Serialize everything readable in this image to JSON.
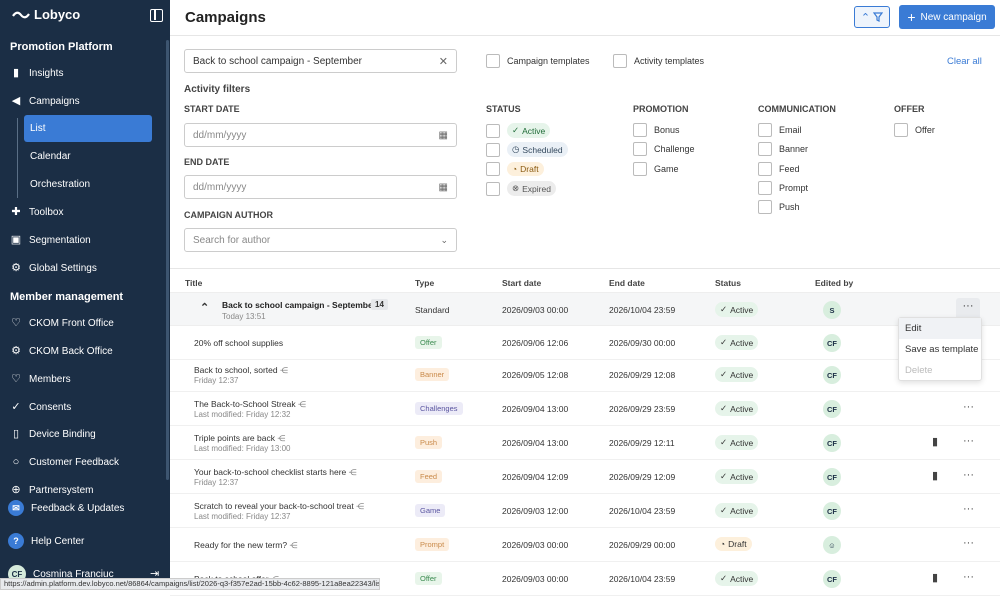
{
  "app": {
    "name": "Lobyco"
  },
  "sidebar": {
    "section1": "Promotion Platform",
    "items1": [
      {
        "label": "Insights",
        "icon": "bar-chart-icon"
      },
      {
        "label": "Campaigns",
        "icon": "megaphone-icon"
      }
    ],
    "campaign_sub": [
      "List",
      "Calendar",
      "Orchestration"
    ],
    "items2": [
      {
        "label": "Toolbox",
        "icon": "puzzle-icon"
      },
      {
        "label": "Segmentation",
        "icon": "segment-icon"
      },
      {
        "label": "Global Settings",
        "icon": "gear-icon"
      }
    ],
    "section2": "Member management",
    "items3": [
      {
        "label": "CKOM Front Office",
        "icon": "heart-icon"
      },
      {
        "label": "CKOM Back Office",
        "icon": "gear-icon"
      },
      {
        "label": "Members",
        "icon": "heart-icon"
      },
      {
        "label": "Consents",
        "icon": "check-circle-icon"
      },
      {
        "label": "Device Binding",
        "icon": "phone-icon"
      },
      {
        "label": "Customer Feedback",
        "icon": "chat-icon"
      },
      {
        "label": "Partnersystem",
        "icon": "partner-icon"
      }
    ],
    "bottom": {
      "feedback": "Feedback & Updates",
      "help": "Help Center",
      "user_initials": "CF",
      "user_name": "Cosmina Franciuc"
    }
  },
  "header": {
    "title": "Campaigns",
    "new_button": "New campaign"
  },
  "filters": {
    "search_value": "Back to school campaign - September",
    "campaign_templates": "Campaign templates",
    "activity_templates": "Activity templates",
    "clear_all": "Clear all",
    "activity_filters": "Activity filters",
    "start_date_label": "START DATE",
    "end_date_label": "END DATE",
    "date_placeholder": "dd/mm/yyyy",
    "author_label": "CAMPAIGN AUTHOR",
    "author_placeholder": "Search for author",
    "status_label": "STATUS",
    "status_options": [
      "Active",
      "Scheduled",
      "Draft",
      "Expired"
    ],
    "promotion_label": "PROMOTION",
    "promotion_options": [
      "Bonus",
      "Challenge",
      "Game"
    ],
    "communication_label": "COMMUNICATION",
    "communication_options": [
      "Email",
      "Banner",
      "Feed",
      "Prompt",
      "Push"
    ],
    "offer_label": "OFFER",
    "offer_options": [
      "Offer"
    ]
  },
  "table": {
    "headers": [
      "Title",
      "Type",
      "Start date",
      "End date",
      "Status",
      "Edited by"
    ],
    "group": {
      "title": "Back to school campaign - September",
      "count": "14",
      "subtitle": "Today 13:51",
      "type": "Standard",
      "start": "2026/09/03 00:00",
      "end": "2026/10/04 23:59",
      "status": "Active",
      "edited_by": "S"
    },
    "rows": [
      {
        "title": "20% off school supplies",
        "sub": "",
        "type": "Offer",
        "start": "2026/09/06 12:06",
        "end": "2026/09/30 00:00",
        "status": "Active",
        "editor": "CF",
        "share": false,
        "chart": false,
        "dots": false
      },
      {
        "title": "Back to school, sorted",
        "sub": "Friday 12:37",
        "type": "Banner",
        "start": "2026/09/05 12:08",
        "end": "2026/09/29 12:08",
        "status": "Active",
        "editor": "CF",
        "share": true,
        "chart": false,
        "dots": false
      },
      {
        "title": "The Back-to-School Streak",
        "sub": "Last modified: Friday 12:32",
        "type": "Challenges",
        "start": "2026/09/04 13:00",
        "end": "2026/09/29 23:59",
        "status": "Active",
        "editor": "CF",
        "share": true,
        "chart": false,
        "dots": true
      },
      {
        "title": "Triple points are back",
        "sub": "Last modified: Friday 13:00",
        "type": "Push",
        "start": "2026/09/04 13:00",
        "end": "2026/09/29 12:11",
        "status": "Active",
        "editor": "CF",
        "share": true,
        "chart": true,
        "dots": true
      },
      {
        "title": "Your back-to-school checklist starts here",
        "sub": "Friday 12:37",
        "type": "Feed",
        "start": "2026/09/04 12:09",
        "end": "2026/09/29 12:09",
        "status": "Active",
        "editor": "CF",
        "share": true,
        "chart": true,
        "dots": true
      },
      {
        "title": "Scratch to reveal your back-to-school treat",
        "sub": "Last modified: Friday 12:37",
        "type": "Game",
        "start": "2026/09/03 12:00",
        "end": "2026/10/04 23:59",
        "status": "Active",
        "editor": "CF",
        "share": true,
        "chart": false,
        "dots": true
      },
      {
        "title": "Ready for the new term?",
        "sub": "",
        "type": "Prompt",
        "start": "2026/09/03 00:00",
        "end": "2026/09/29 00:00",
        "status": "Draft",
        "editor": "",
        "share": true,
        "chart": false,
        "dots": true
      },
      {
        "title": "Back to school offer",
        "sub": "",
        "type": "Offer",
        "start": "2026/09/03 00:00",
        "end": "2026/10/04 23:59",
        "status": "Active",
        "editor": "CF",
        "share": true,
        "chart": true,
        "dots": true
      }
    ]
  },
  "context_menu": [
    "Edit",
    "Save as template",
    "Delete"
  ],
  "statusbar_url": "https://admin.platform.dev.lobyco.net/86864/campaigns/list/2026-q3-f357e2ad-15bb-4c62-8895-121a8ea22343/list",
  "type_colors": {
    "Offer": "#e8f5ea",
    "Banner": "#fdeede",
    "Challenges": "#ecebf7",
    "Push": "#fdeede",
    "Feed": "#fdeede",
    "Game": "#ecebf7",
    "Prompt": "#fdeede"
  },
  "type_text_colors": {
    "Offer": "#3a8a4f",
    "Banner": "#c98a4a",
    "Challenges": "#5a55a0",
    "Push": "#c98a4a",
    "Feed": "#c98a4a",
    "Game": "#5a55a0",
    "Prompt": "#c98a4a"
  }
}
